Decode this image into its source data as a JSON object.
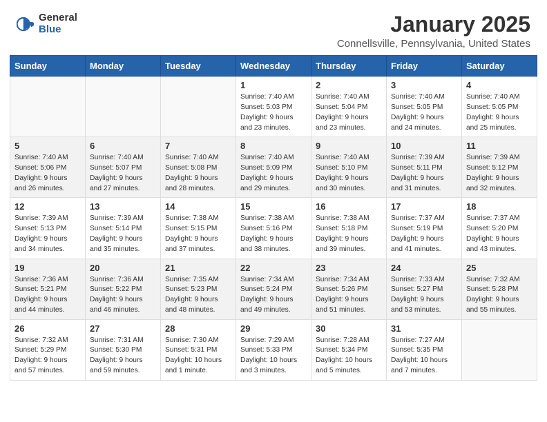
{
  "header": {
    "logo_general": "General",
    "logo_blue": "Blue",
    "month_title": "January 2025",
    "location": "Connellsville, Pennsylvania, United States"
  },
  "days_of_week": [
    "Sunday",
    "Monday",
    "Tuesday",
    "Wednesday",
    "Thursday",
    "Friday",
    "Saturday"
  ],
  "weeks": [
    [
      {
        "day": "",
        "empty": true
      },
      {
        "day": "",
        "empty": true
      },
      {
        "day": "",
        "empty": true
      },
      {
        "day": "1",
        "sunrise": "7:40 AM",
        "sunset": "5:03 PM",
        "daylight": "9 hours and 23 minutes."
      },
      {
        "day": "2",
        "sunrise": "7:40 AM",
        "sunset": "5:04 PM",
        "daylight": "9 hours and 23 minutes."
      },
      {
        "day": "3",
        "sunrise": "7:40 AM",
        "sunset": "5:05 PM",
        "daylight": "9 hours and 24 minutes."
      },
      {
        "day": "4",
        "sunrise": "7:40 AM",
        "sunset": "5:05 PM",
        "daylight": "9 hours and 25 minutes."
      }
    ],
    [
      {
        "day": "5",
        "sunrise": "7:40 AM",
        "sunset": "5:06 PM",
        "daylight": "9 hours and 26 minutes."
      },
      {
        "day": "6",
        "sunrise": "7:40 AM",
        "sunset": "5:07 PM",
        "daylight": "9 hours and 27 minutes."
      },
      {
        "day": "7",
        "sunrise": "7:40 AM",
        "sunset": "5:08 PM",
        "daylight": "9 hours and 28 minutes."
      },
      {
        "day": "8",
        "sunrise": "7:40 AM",
        "sunset": "5:09 PM",
        "daylight": "9 hours and 29 minutes."
      },
      {
        "day": "9",
        "sunrise": "7:40 AM",
        "sunset": "5:10 PM",
        "daylight": "9 hours and 30 minutes."
      },
      {
        "day": "10",
        "sunrise": "7:39 AM",
        "sunset": "5:11 PM",
        "daylight": "9 hours and 31 minutes."
      },
      {
        "day": "11",
        "sunrise": "7:39 AM",
        "sunset": "5:12 PM",
        "daylight": "9 hours and 32 minutes."
      }
    ],
    [
      {
        "day": "12",
        "sunrise": "7:39 AM",
        "sunset": "5:13 PM",
        "daylight": "9 hours and 34 minutes."
      },
      {
        "day": "13",
        "sunrise": "7:39 AM",
        "sunset": "5:14 PM",
        "daylight": "9 hours and 35 minutes."
      },
      {
        "day": "14",
        "sunrise": "7:38 AM",
        "sunset": "5:15 PM",
        "daylight": "9 hours and 37 minutes."
      },
      {
        "day": "15",
        "sunrise": "7:38 AM",
        "sunset": "5:16 PM",
        "daylight": "9 hours and 38 minutes."
      },
      {
        "day": "16",
        "sunrise": "7:38 AM",
        "sunset": "5:18 PM",
        "daylight": "9 hours and 39 minutes."
      },
      {
        "day": "17",
        "sunrise": "7:37 AM",
        "sunset": "5:19 PM",
        "daylight": "9 hours and 41 minutes."
      },
      {
        "day": "18",
        "sunrise": "7:37 AM",
        "sunset": "5:20 PM",
        "daylight": "9 hours and 43 minutes."
      }
    ],
    [
      {
        "day": "19",
        "sunrise": "7:36 AM",
        "sunset": "5:21 PM",
        "daylight": "9 hours and 44 minutes."
      },
      {
        "day": "20",
        "sunrise": "7:36 AM",
        "sunset": "5:22 PM",
        "daylight": "9 hours and 46 minutes."
      },
      {
        "day": "21",
        "sunrise": "7:35 AM",
        "sunset": "5:23 PM",
        "daylight": "9 hours and 48 minutes."
      },
      {
        "day": "22",
        "sunrise": "7:34 AM",
        "sunset": "5:24 PM",
        "daylight": "9 hours and 49 minutes."
      },
      {
        "day": "23",
        "sunrise": "7:34 AM",
        "sunset": "5:26 PM",
        "daylight": "9 hours and 51 minutes."
      },
      {
        "day": "24",
        "sunrise": "7:33 AM",
        "sunset": "5:27 PM",
        "daylight": "9 hours and 53 minutes."
      },
      {
        "day": "25",
        "sunrise": "7:32 AM",
        "sunset": "5:28 PM",
        "daylight": "9 hours and 55 minutes."
      }
    ],
    [
      {
        "day": "26",
        "sunrise": "7:32 AM",
        "sunset": "5:29 PM",
        "daylight": "9 hours and 57 minutes."
      },
      {
        "day": "27",
        "sunrise": "7:31 AM",
        "sunset": "5:30 PM",
        "daylight": "9 hours and 59 minutes."
      },
      {
        "day": "28",
        "sunrise": "7:30 AM",
        "sunset": "5:31 PM",
        "daylight": "10 hours and 1 minute."
      },
      {
        "day": "29",
        "sunrise": "7:29 AM",
        "sunset": "5:33 PM",
        "daylight": "10 hours and 3 minutes."
      },
      {
        "day": "30",
        "sunrise": "7:28 AM",
        "sunset": "5:34 PM",
        "daylight": "10 hours and 5 minutes."
      },
      {
        "day": "31",
        "sunrise": "7:27 AM",
        "sunset": "5:35 PM",
        "daylight": "10 hours and 7 minutes."
      },
      {
        "day": "",
        "empty": true
      }
    ]
  ],
  "labels": {
    "sunrise": "Sunrise:",
    "sunset": "Sunset:",
    "daylight": "Daylight:"
  }
}
